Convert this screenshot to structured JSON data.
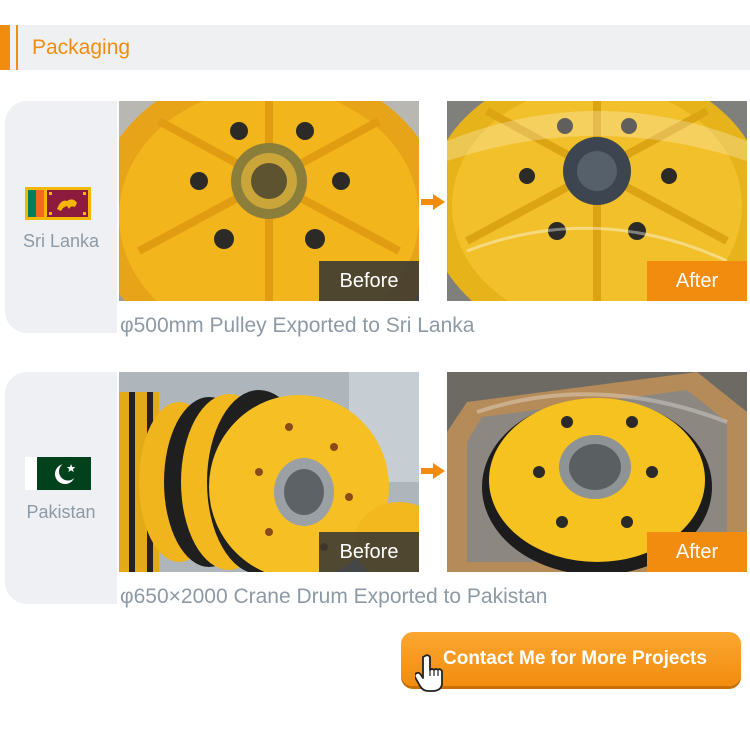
{
  "header": {
    "title": "Packaging"
  },
  "colors": {
    "accent": "#f28c0f",
    "muted_text": "#8d9aa6",
    "card_bg": "#eef0f4"
  },
  "projects": [
    {
      "country": "Sri Lanka",
      "flag_icon": "sri-lanka-flag-icon",
      "before_label": "Before",
      "after_label": "After",
      "caption": "φ500mm Pulley Exported to Sri Lanka"
    },
    {
      "country": "Pakistan",
      "flag_icon": "pakistan-flag-icon",
      "before_label": "Before",
      "after_label": "After",
      "caption": "φ650×2000 Crane Drum Exported to Pakistan"
    }
  ],
  "cta": {
    "label": "Contact Me for More Projects",
    "icon": "hand-pointer-icon"
  }
}
